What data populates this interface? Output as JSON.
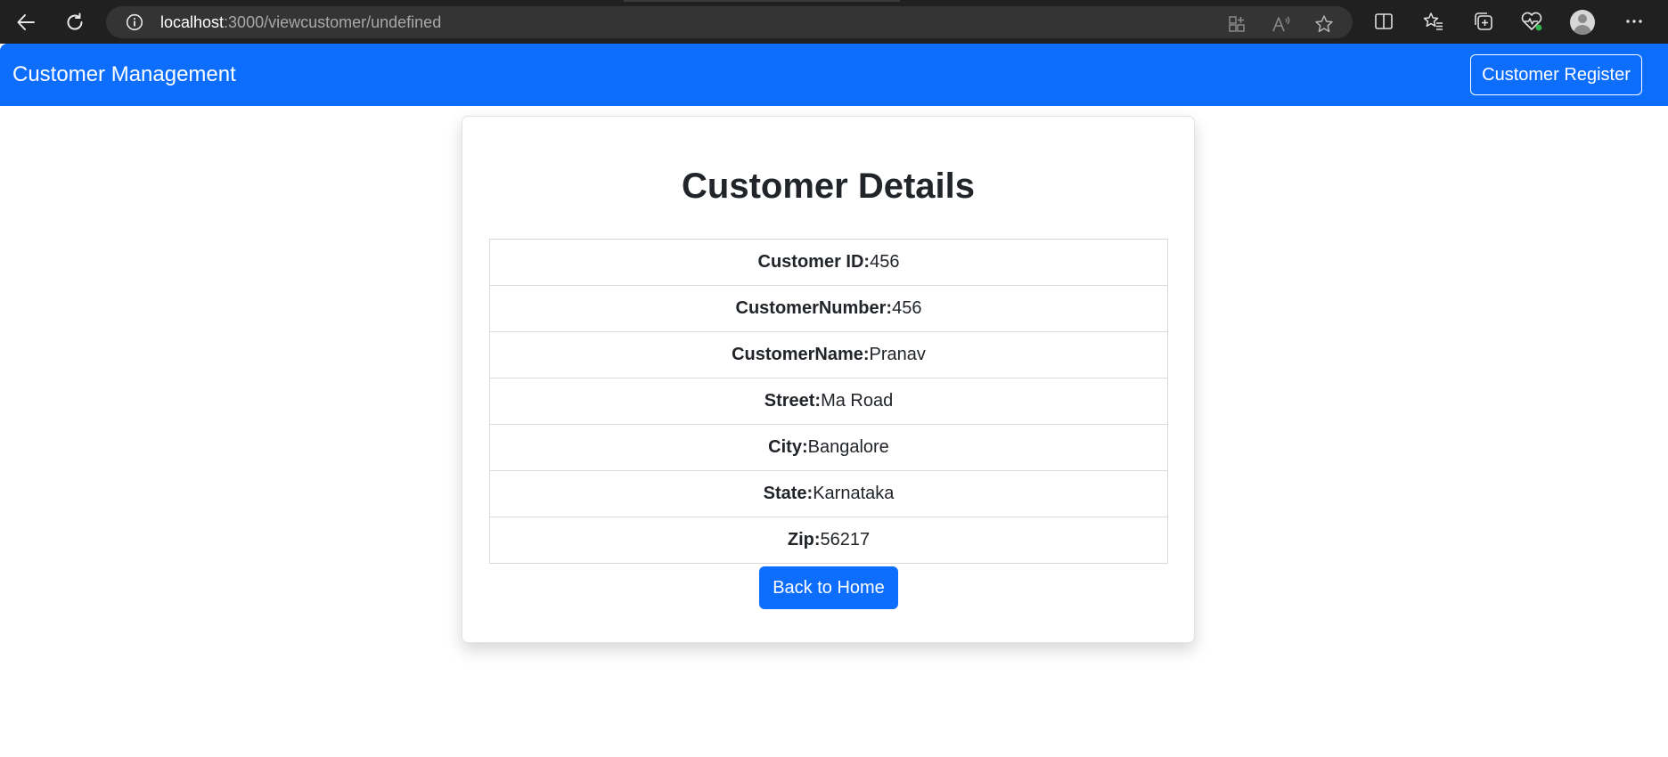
{
  "browser": {
    "url_host": "localhost",
    "url_path": ":3000/viewcustomer/undefined",
    "icons": [
      "back-arrow-icon",
      "refresh-icon",
      "info-icon",
      "apps-icon",
      "read-aloud-icon",
      "favorite-star-icon",
      "split-screen-icon",
      "favorites-icon",
      "collections-icon",
      "browser-essentials-icon",
      "profile-avatar-icon",
      "more-options-icon"
    ]
  },
  "navbar": {
    "brand": "Customer Management",
    "register_label": "Customer Register",
    "color": "#0d6efd"
  },
  "card": {
    "title": "Customer Details",
    "rows": [
      {
        "label": "Customer ID:",
        "value": "456"
      },
      {
        "label": "CustomerNumber:",
        "value": "456"
      },
      {
        "label": "CustomerName:",
        "value": "Pranav"
      },
      {
        "label": "Street:",
        "value": "Ma Road"
      },
      {
        "label": "City:",
        "value": "Bangalore"
      },
      {
        "label": "State:",
        "value": "Karnataka"
      },
      {
        "label": "Zip:",
        "value": "56217"
      }
    ],
    "back_label": "Back to Home"
  }
}
